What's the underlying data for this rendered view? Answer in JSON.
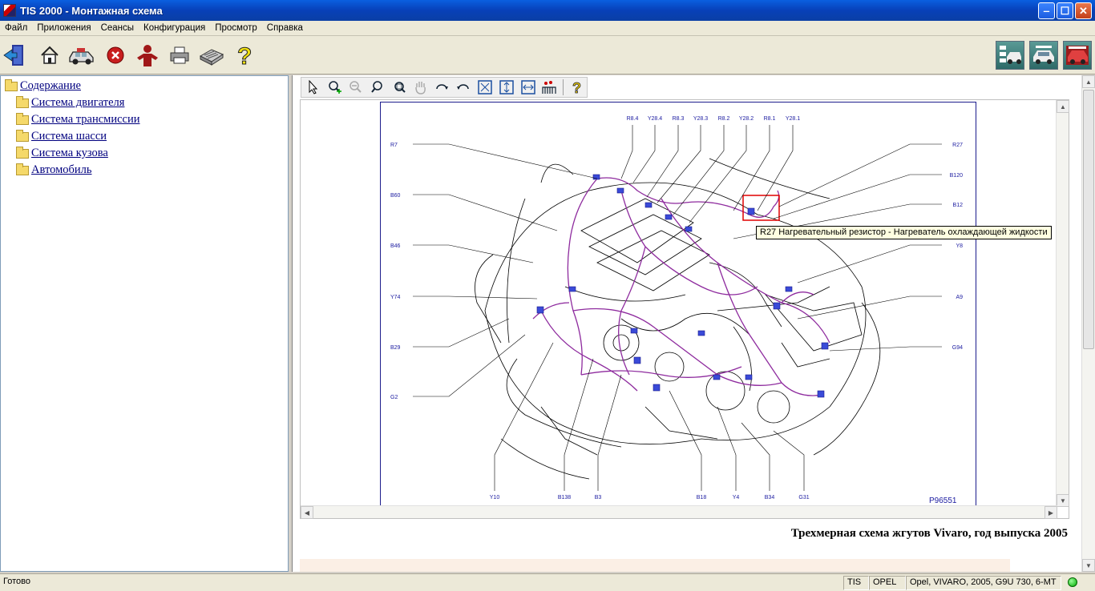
{
  "window": {
    "title": "TIS 2000 - Монтажная схема"
  },
  "menu": [
    "Файл",
    "Приложения",
    "Сеансы",
    "Конфигурация",
    "Просмотр",
    "Справка"
  ],
  "tree": {
    "root": "Содержание",
    "items": [
      "Система двигателя",
      "Система трансмиссии",
      "Система шасси",
      "Система кузова",
      "Автомобиль"
    ]
  },
  "diagram": {
    "top_labels": [
      "R8.4",
      "Y28.4",
      "R8.3",
      "Y28.3",
      "R8.2",
      "Y28.2",
      "R8.1",
      "Y28.1"
    ],
    "left_labels": [
      "R7",
      "B60",
      "B46",
      "Y74",
      "B29",
      "G2"
    ],
    "right_labels": [
      "R27",
      "B120",
      "B12",
      "Y8",
      "A9",
      "G94"
    ],
    "bottom_labels": [
      "Y10",
      "B138",
      "B3",
      "B18",
      "Y4",
      "B34",
      "G31"
    ],
    "drawing_number": "P96551"
  },
  "tooltip": "R27 Нагревательный резистор - Нагреватель охлаждающей жидкости",
  "caption": "Трехмерная схема жгутов Vivaro, год выпуска 2005",
  "status": {
    "text": "Готово",
    "app": "TIS",
    "make": "OPEL",
    "vehicle": "Opel, VIVARO, 2005, G9U 730, 6-MT"
  },
  "colors": {
    "harness": "#8e2b9e",
    "labels": "#1a1aa0",
    "highlight": "#e00000"
  }
}
